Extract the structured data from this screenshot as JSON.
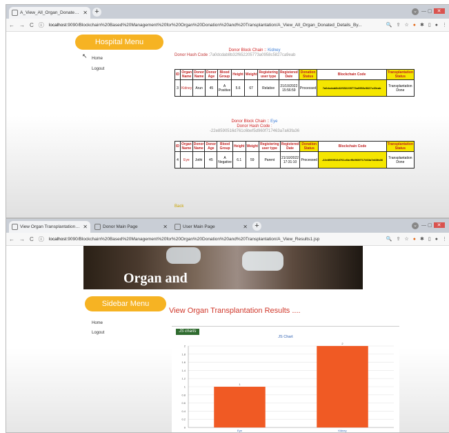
{
  "window1": {
    "tabs": [
      {
        "label": "A_View_All_Organ_Donated_Det..."
      }
    ],
    "url_host": "localhost",
    "url_path": ":9090/Blockchain%20Based%20Management%20for%20Organ%20Donation%20and%20Transplantation/A_View_All_Organ_Donated_Details_By...",
    "sidebar": {
      "title": "Hospital Menu",
      "items": [
        "Home",
        "Logout"
      ]
    },
    "block1": {
      "chain_label": "Donor Block Chain :: ",
      "chain_value": "Kidney",
      "hash_label": "Donor Hash Code :",
      "hash_value": "7a0dcdab8b32f652205773a0958c5827ca9eab"
    },
    "block2": {
      "chain_label": "Donor Block Chain :: ",
      "chain_value": "Eye",
      "hash_label": "Donor Hash Code :",
      "hash_value": "-22e8590516d761c6bef5d960f717463a7a63fa36"
    },
    "table_headers": [
      "ID",
      "Organ Name",
      "Donor Name",
      "Donor Age",
      "Blood Group",
      "Height",
      "Weight",
      "Registering user type",
      "Registered Date",
      "Donation Status",
      "Blockchain Code",
      "Transplantation Status"
    ],
    "rows": [
      [
        "3",
        "Kidney",
        "Arun",
        "45",
        "A Positive",
        "5.6",
        "67",
        "Relative",
        "21/10/2022 15:56:59",
        "Processed",
        "7a0dcdab8b32f652205773a0958c5827c49eab",
        "Transplantation Done"
      ],
      [
        "4",
        "Eye",
        "Jothi",
        "45",
        "A Negative",
        "6.1",
        "59",
        "Parent",
        "21/10/2022 17:31:10",
        "Processed",
        "-22e8590516d761c6bef5d960f717463a7a63fa36",
        "Transplantation Done"
      ]
    ],
    "back_link": "Back"
  },
  "window2": {
    "tabs": [
      {
        "label": "View Organ Transplantation Res..."
      },
      {
        "label": "Donor Main Page"
      },
      {
        "label": "User Main Page"
      }
    ],
    "url_host": "localhost",
    "url_path": ":9090/Blockchain%20Based%20Management%20for%20Organ%20Donation%20and%20Transplantation/A_View_Results1.jsp",
    "banner_text": "Organ and",
    "sidebar": {
      "title": "Sidebar Menu",
      "items": [
        "Home",
        "Logout"
      ]
    },
    "results_title": "View Organ Transplantation Results ....",
    "logo_text": "JS charts"
  },
  "chart_data": {
    "type": "bar",
    "title": "JS Chart",
    "categories": [
      "Eye",
      "Kidney"
    ],
    "values": [
      1,
      2
    ],
    "xlabel": "",
    "ylabel": "",
    "ylim": [
      0,
      2
    ],
    "yticks": [
      "0",
      "0.2",
      "0.4",
      "0.6",
      "0.8",
      "1",
      "1.2",
      "1.4",
      "1.6",
      "1.8",
      "2"
    ],
    "bar_color": "#f05a24",
    "grid": true
  },
  "colors": {
    "accent": "#f6b323",
    "header_red": "#c0201f",
    "highlight": "#f5e600"
  }
}
